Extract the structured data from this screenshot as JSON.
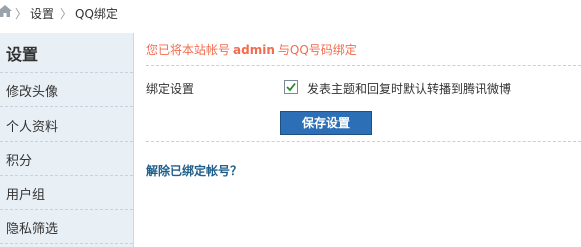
{
  "breadcrumb": {
    "home_icon": "home-icon",
    "separator": "〉",
    "items": [
      "设置",
      "QQ绑定"
    ]
  },
  "sidebar": {
    "title": "设置",
    "items": [
      "修改头像",
      "个人资料",
      "积分",
      "用户组",
      "隐私筛选"
    ]
  },
  "main": {
    "notice_prefix": "您已将本站帐号",
    "account": "admin",
    "notice_suffix": "与QQ号码绑定",
    "setting_label": "绑定设置",
    "checkbox_checked": true,
    "checkbox_label": "发表主题和回复时默认转播到腾讯微博",
    "save_label": "保存设置",
    "unbind_label": "解除已绑定帐号？"
  },
  "colors": {
    "notice": "#f26c4f",
    "button": "#2c6fb6",
    "link": "#1f5f8b",
    "sidebar_bg": "#e8eff5"
  }
}
